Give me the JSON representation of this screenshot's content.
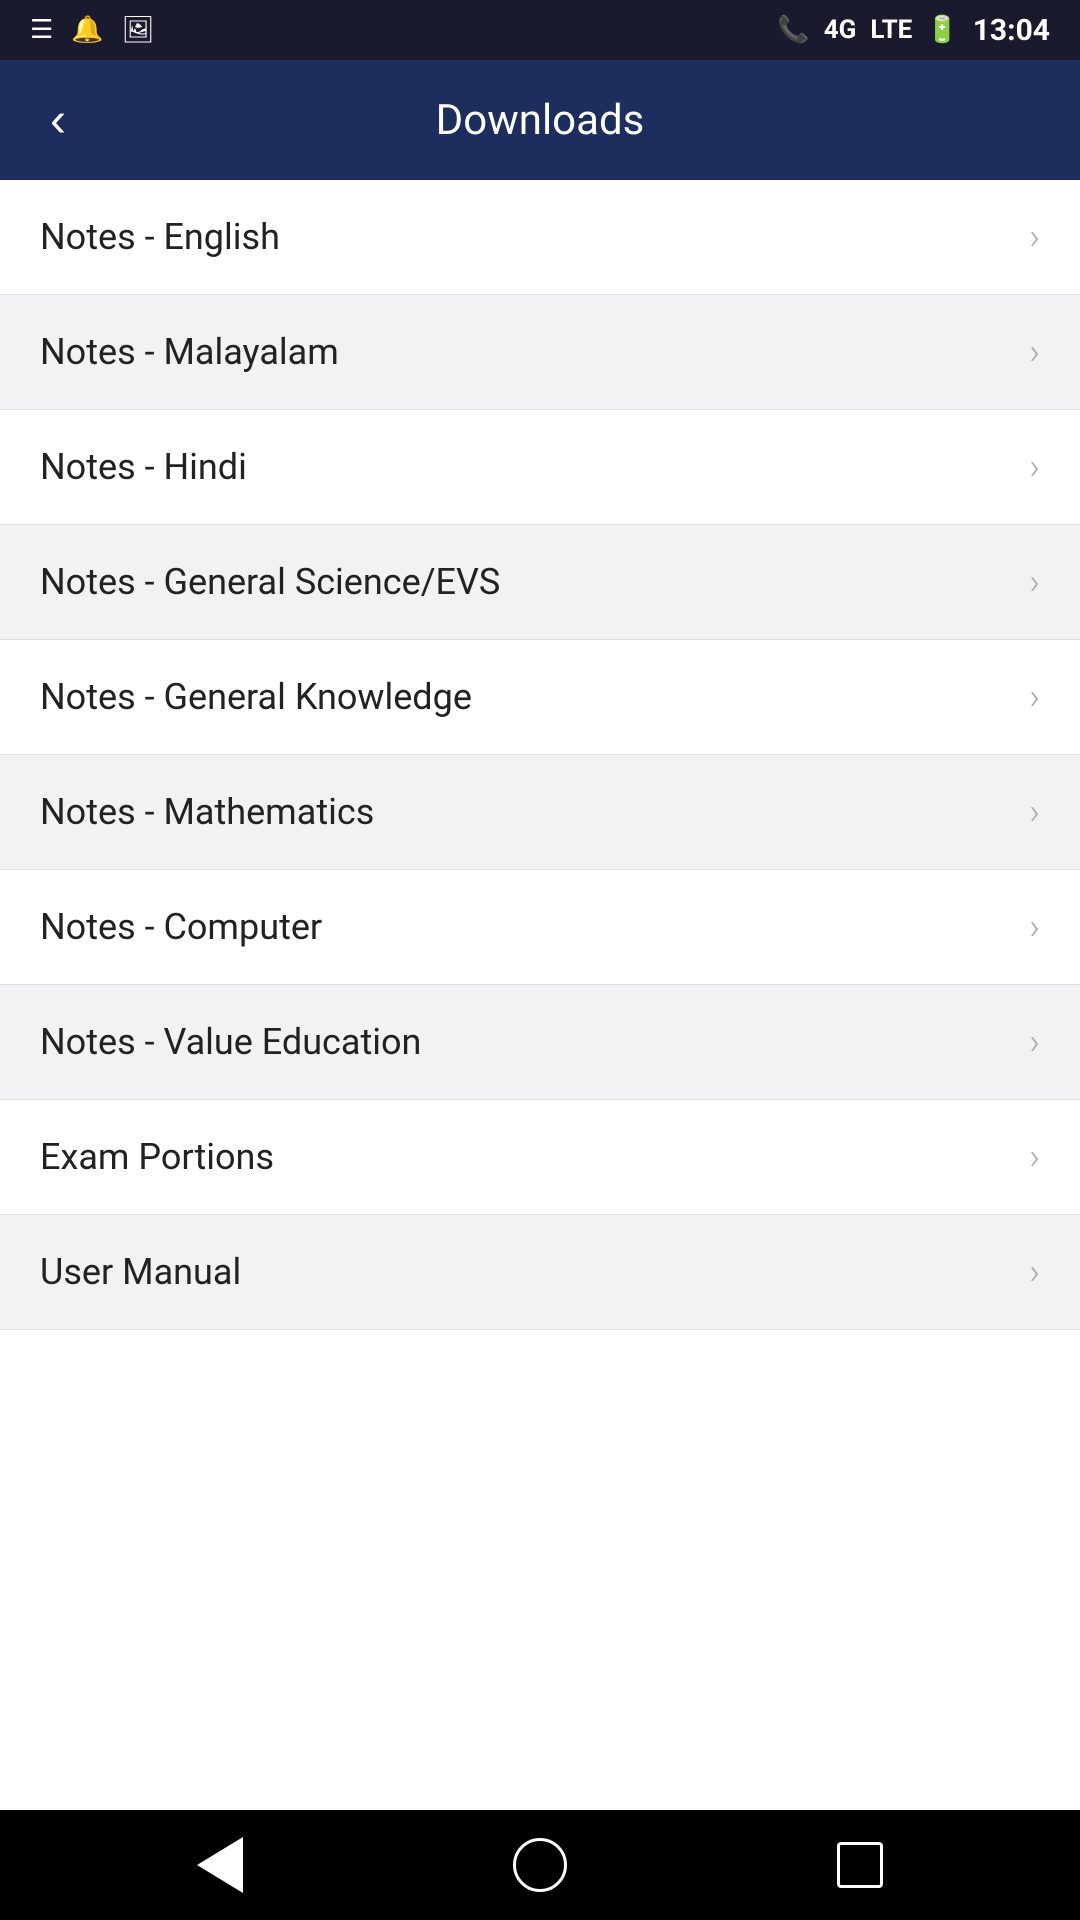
{
  "statusBar": {
    "time": "13:04",
    "icons": [
      "menu-icon",
      "notification-icon",
      "image-icon",
      "phone-icon",
      "signal-4g-icon",
      "lte-icon",
      "battery-icon"
    ]
  },
  "header": {
    "title": "Downloads",
    "backLabel": "<"
  },
  "listItems": [
    {
      "id": 1,
      "label": "Notes - English"
    },
    {
      "id": 2,
      "label": "Notes - Malayalam"
    },
    {
      "id": 3,
      "label": "Notes - Hindi"
    },
    {
      "id": 4,
      "label": "Notes - General Science/EVS"
    },
    {
      "id": 5,
      "label": "Notes - General Knowledge"
    },
    {
      "id": 6,
      "label": "Notes - Mathematics"
    },
    {
      "id": 7,
      "label": "Notes - Computer"
    },
    {
      "id": 8,
      "label": "Notes - Value Education"
    },
    {
      "id": 9,
      "label": "Exam Portions"
    },
    {
      "id": 10,
      "label": "User Manual"
    }
  ],
  "bottomNav": {
    "back": "back",
    "home": "home",
    "recents": "recents"
  }
}
